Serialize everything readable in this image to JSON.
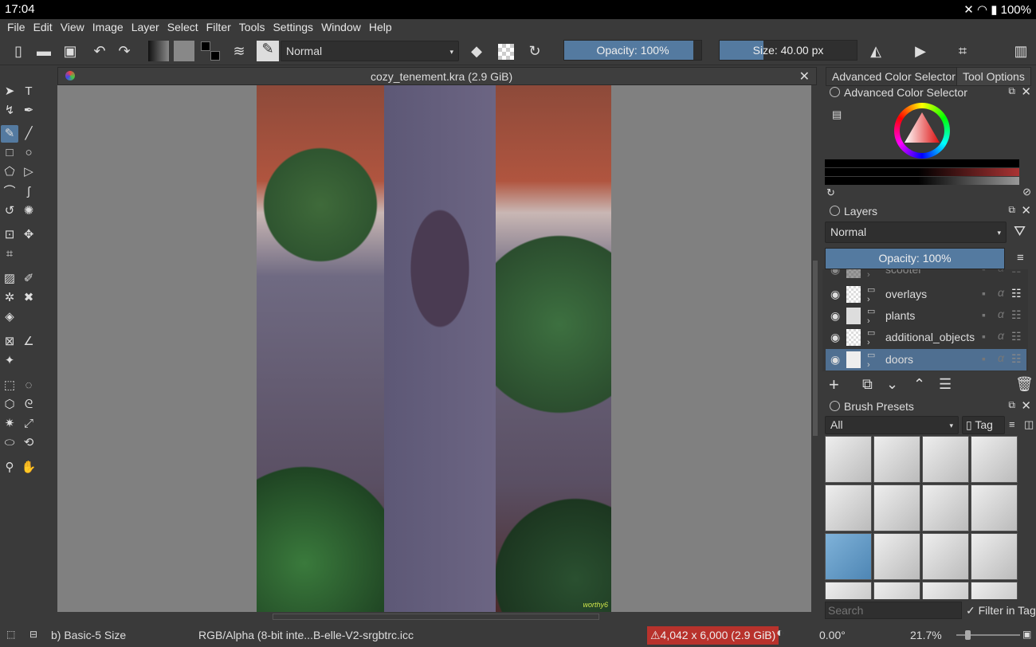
{
  "system": {
    "time": "17:04",
    "battery": "100%"
  },
  "menu": [
    "File",
    "Edit",
    "View",
    "Image",
    "Layer",
    "Select",
    "Filter",
    "Tools",
    "Settings",
    "Window",
    "Help"
  ],
  "toolbar": {
    "blend_mode": "Normal",
    "opacity": "Opacity: 100%",
    "opacity_value": 100,
    "size": "Size: 40.00 px",
    "size_fraction": 0.4
  },
  "document": {
    "title": "cozy_tenement.kra (2.9 GiB)",
    "signature": "worthy6"
  },
  "dock": {
    "tabs": [
      "Advanced Color Selector",
      "Tool Options"
    ],
    "color_selector": {
      "title": "Advanced Color Selector"
    },
    "layers": {
      "title": "Layers",
      "blend_mode": "Normal",
      "opacity": "Opacity:  100%",
      "items": [
        {
          "name": "scooter",
          "selected": false
        },
        {
          "name": "overlays",
          "selected": false
        },
        {
          "name": "plants",
          "selected": false
        },
        {
          "name": "additional_objects",
          "selected": false
        },
        {
          "name": "doors",
          "selected": true
        }
      ]
    },
    "brush_presets": {
      "title": "Brush Presets",
      "filter": "All",
      "tag": "Tag",
      "search_placeholder": "Search",
      "filter_in_tag": "Filter in Tag"
    }
  },
  "status": {
    "brush": "b) Basic-5 Size",
    "color_profile": "RGB/Alpha (8-bit inte...B-elle-V2-srgbtrc.icc",
    "dimensions": "⚠4,042 x 6,000 (2.9 GiB)",
    "rotation": "0.00°",
    "zoom": "21.7%"
  },
  "colors": {
    "accent": "#547aa0",
    "warning": "#b8322c"
  }
}
